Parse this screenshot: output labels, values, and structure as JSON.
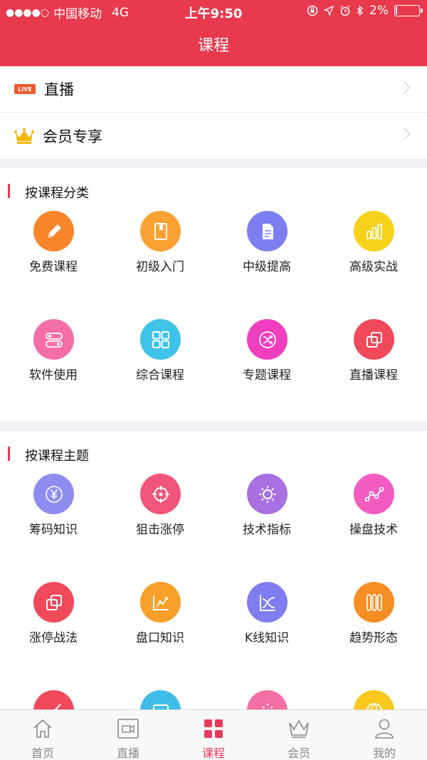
{
  "status_bar": {
    "carrier": "中国移动",
    "network": "4G",
    "time": "上午9:50",
    "battery": "2%"
  },
  "nav": {
    "title": "课程"
  },
  "top_list": [
    {
      "label": "直播",
      "badge": "LIVE",
      "icon": "live-badge-icon"
    },
    {
      "label": "会员专享",
      "icon": "crown-icon"
    }
  ],
  "sections": [
    {
      "title": "按课程分类",
      "items": [
        {
          "label": "免费课程",
          "icon": "pencil-icon",
          "color": "#f7852b"
        },
        {
          "label": "初级入门",
          "icon": "book-icon",
          "color": "#f9a233"
        },
        {
          "label": "中级提高",
          "icon": "document-icon",
          "color": "#7c7ef2"
        },
        {
          "label": "高级实战",
          "icon": "bar-chart-icon",
          "color": "#f7d21c"
        },
        {
          "label": "软件使用",
          "icon": "toggle-icon",
          "color": "#f46fa6"
        },
        {
          "label": "综合课程",
          "icon": "grid-icon",
          "color": "#3fc3e8"
        },
        {
          "label": "专题课程",
          "icon": "shuffle-icon",
          "color": "#ef3fbe"
        },
        {
          "label": "直播课程",
          "icon": "chain-icon",
          "color": "#f0495a"
        }
      ]
    },
    {
      "title": "按课程主题",
      "items": [
        {
          "label": "筹码知识",
          "icon": "yuan-coin-icon",
          "color": "#8f8cf0"
        },
        {
          "label": "狙击涨停",
          "icon": "crosshair-icon",
          "color": "#f2557a"
        },
        {
          "label": "技术指标",
          "icon": "sun-icon",
          "color": "#a870e0"
        },
        {
          "label": "操盘技术",
          "icon": "line-nodes-icon",
          "color": "#f25bc0"
        },
        {
          "label": "涨停战法",
          "icon": "chain-icon",
          "color": "#f0495a"
        },
        {
          "label": "盘口知识",
          "icon": "nodes-chart-icon",
          "color": "#f8a02a"
        },
        {
          "label": "K线知识",
          "icon": "curve-chart-icon",
          "color": "#7f7df0"
        },
        {
          "label": "趋势形态",
          "icon": "pillars-icon",
          "color": "#f78e23"
        }
      ],
      "partial_items": [
        {
          "icon": "pencil-icon",
          "color": "#f0495a"
        },
        {
          "icon": "screen-icon",
          "color": "#3fbde8"
        },
        {
          "icon": "sun-icon",
          "color": "#f46fa6"
        },
        {
          "icon": "globe-icon",
          "color": "#f7c91c"
        }
      ]
    }
  ],
  "tabbar": {
    "items": [
      {
        "label": "首页",
        "icon": "home-icon",
        "active": false
      },
      {
        "label": "直播",
        "icon": "video-icon",
        "active": false
      },
      {
        "label": "课程",
        "icon": "grid-icon",
        "active": true
      },
      {
        "label": "会员",
        "icon": "crown-icon",
        "active": false
      },
      {
        "label": "我的",
        "icon": "person-icon",
        "active": false
      }
    ]
  },
  "colors": {
    "primary": "#e8394d",
    "active_tab": "#e8395b",
    "background": "#f1f0f5"
  }
}
